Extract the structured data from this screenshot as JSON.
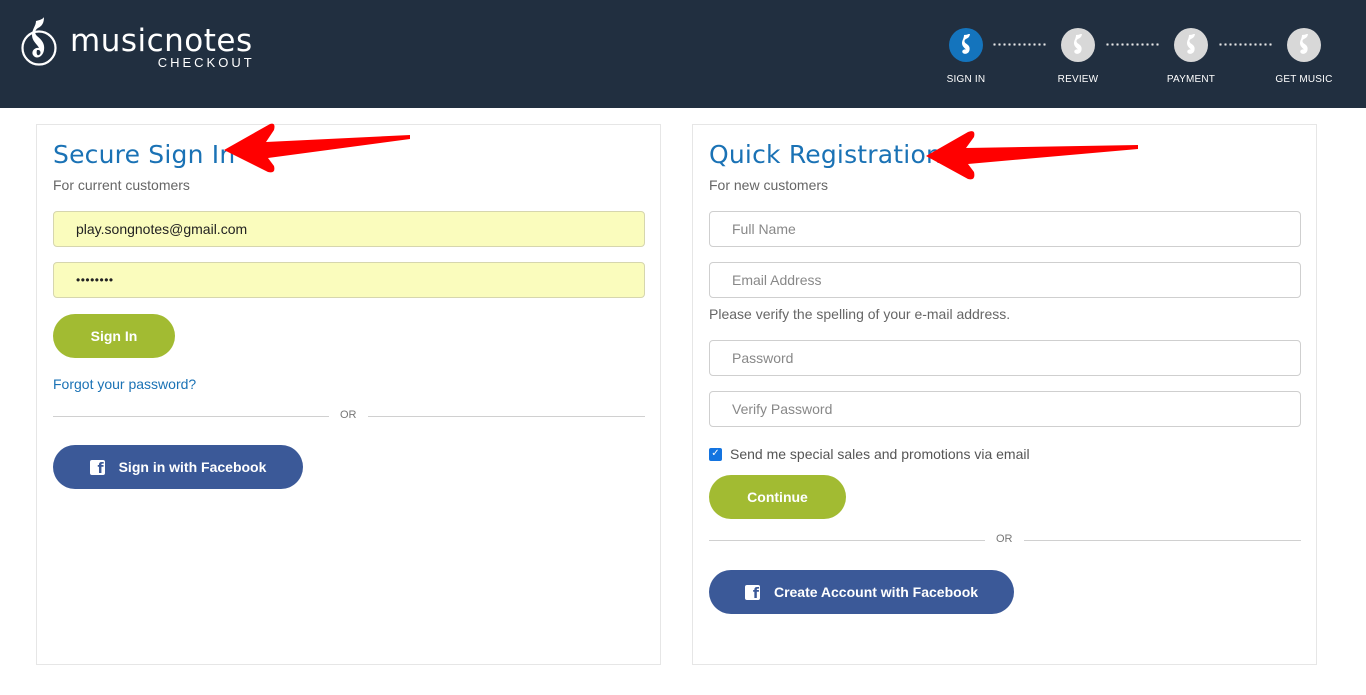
{
  "header": {
    "logo_word": "musicnotes",
    "logo_sub": "CHECKOUT",
    "steps": [
      {
        "label": "SIGN IN",
        "active": true
      },
      {
        "label": "REVIEW",
        "active": false
      },
      {
        "label": "PAYMENT",
        "active": false
      },
      {
        "label": "GET MUSIC",
        "active": false
      }
    ]
  },
  "signin": {
    "title": "Secure Sign In",
    "subtitle": "For current customers",
    "email_value": "play.songnotes@gmail.com",
    "password_value": "••••••••",
    "sign_in_label": "Sign In",
    "forgot_label": "Forgot your password?",
    "or_label": "OR",
    "facebook_label": "Sign in with Facebook"
  },
  "register": {
    "title": "Quick Registration",
    "subtitle": "For new customers",
    "full_name_placeholder": "Full Name",
    "email_placeholder": "Email Address",
    "email_note": "Please verify the spelling of your e-mail address.",
    "password_placeholder": "Password",
    "verify_password_placeholder": "Verify Password",
    "promo_label": "Send me special sales and promotions via email",
    "promo_checked": true,
    "continue_label": "Continue",
    "or_label": "OR",
    "facebook_label": "Create Account with Facebook"
  },
  "colors": {
    "header_bg": "#212f40",
    "accent_blue": "#1a72b5",
    "button_green": "#a2bb32",
    "facebook_blue": "#3b5998",
    "autofill_yellow": "#fafcbd",
    "annotation_red": "#ff0000"
  }
}
